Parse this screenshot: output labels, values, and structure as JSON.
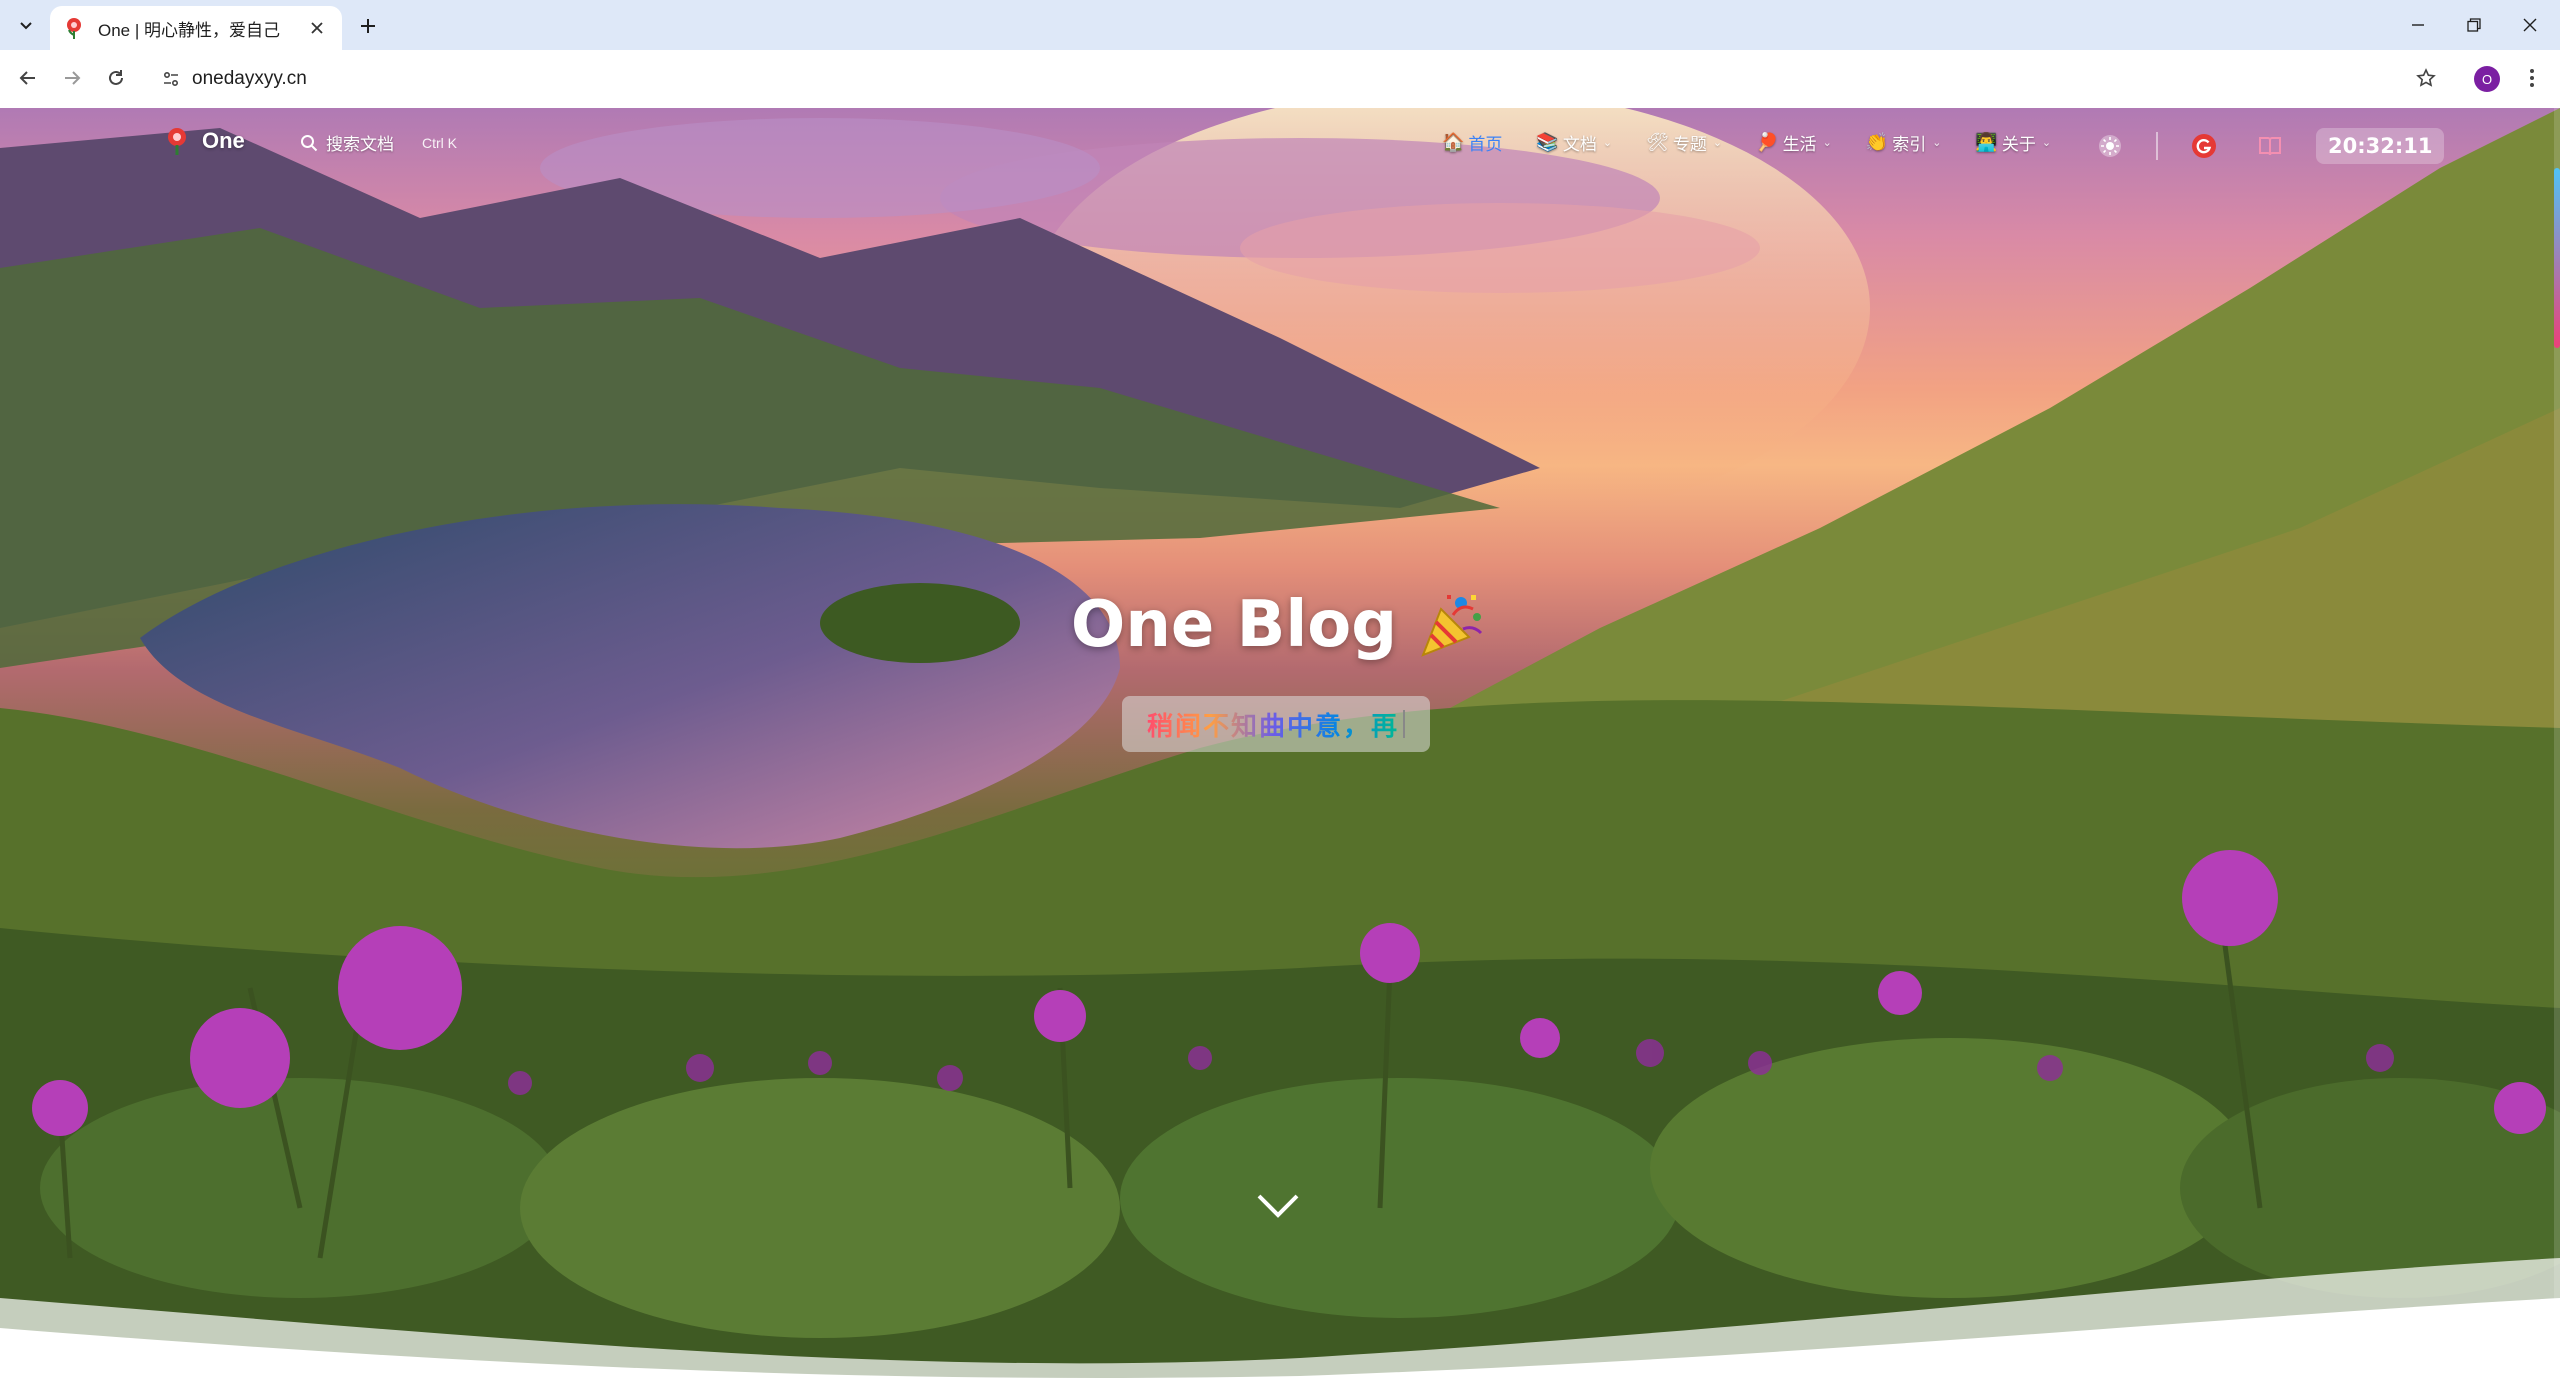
{
  "browser": {
    "tab": {
      "title": "One | 明心静性，爱自己"
    },
    "url": "onedayxyy.cn",
    "profile_initial": "O"
  },
  "site": {
    "brand": "One",
    "search": {
      "placeholder": "搜索文档",
      "shortcut": "Ctrl K"
    },
    "nav": [
      {
        "emoji": "🏠",
        "label": "首页",
        "active": true,
        "dropdown": false
      },
      {
        "emoji": "📚",
        "label": "文档",
        "active": false,
        "dropdown": true
      },
      {
        "emoji": "🛠",
        "label": "专题",
        "active": false,
        "dropdown": true
      },
      {
        "emoji": "🏓",
        "label": "生活",
        "active": false,
        "dropdown": true
      },
      {
        "emoji": "👏",
        "label": "索引",
        "active": false,
        "dropdown": true
      },
      {
        "emoji": "👨‍💻",
        "label": "关于",
        "active": false,
        "dropdown": true
      }
    ],
    "clock": "20:32:11"
  },
  "hero": {
    "title": "One Blog",
    "subtitle": "稍闻不知曲中意，再"
  },
  "colors": {
    "accent": "#3b82f6",
    "tabstrip": "#dee8f8",
    "profile": "#7b1fa2"
  },
  "icons": {
    "theme_toggle": "sun-icon",
    "extension": "g-extension-icon",
    "reader": "book-icon",
    "scroll_down": "chevron-down-icon"
  }
}
